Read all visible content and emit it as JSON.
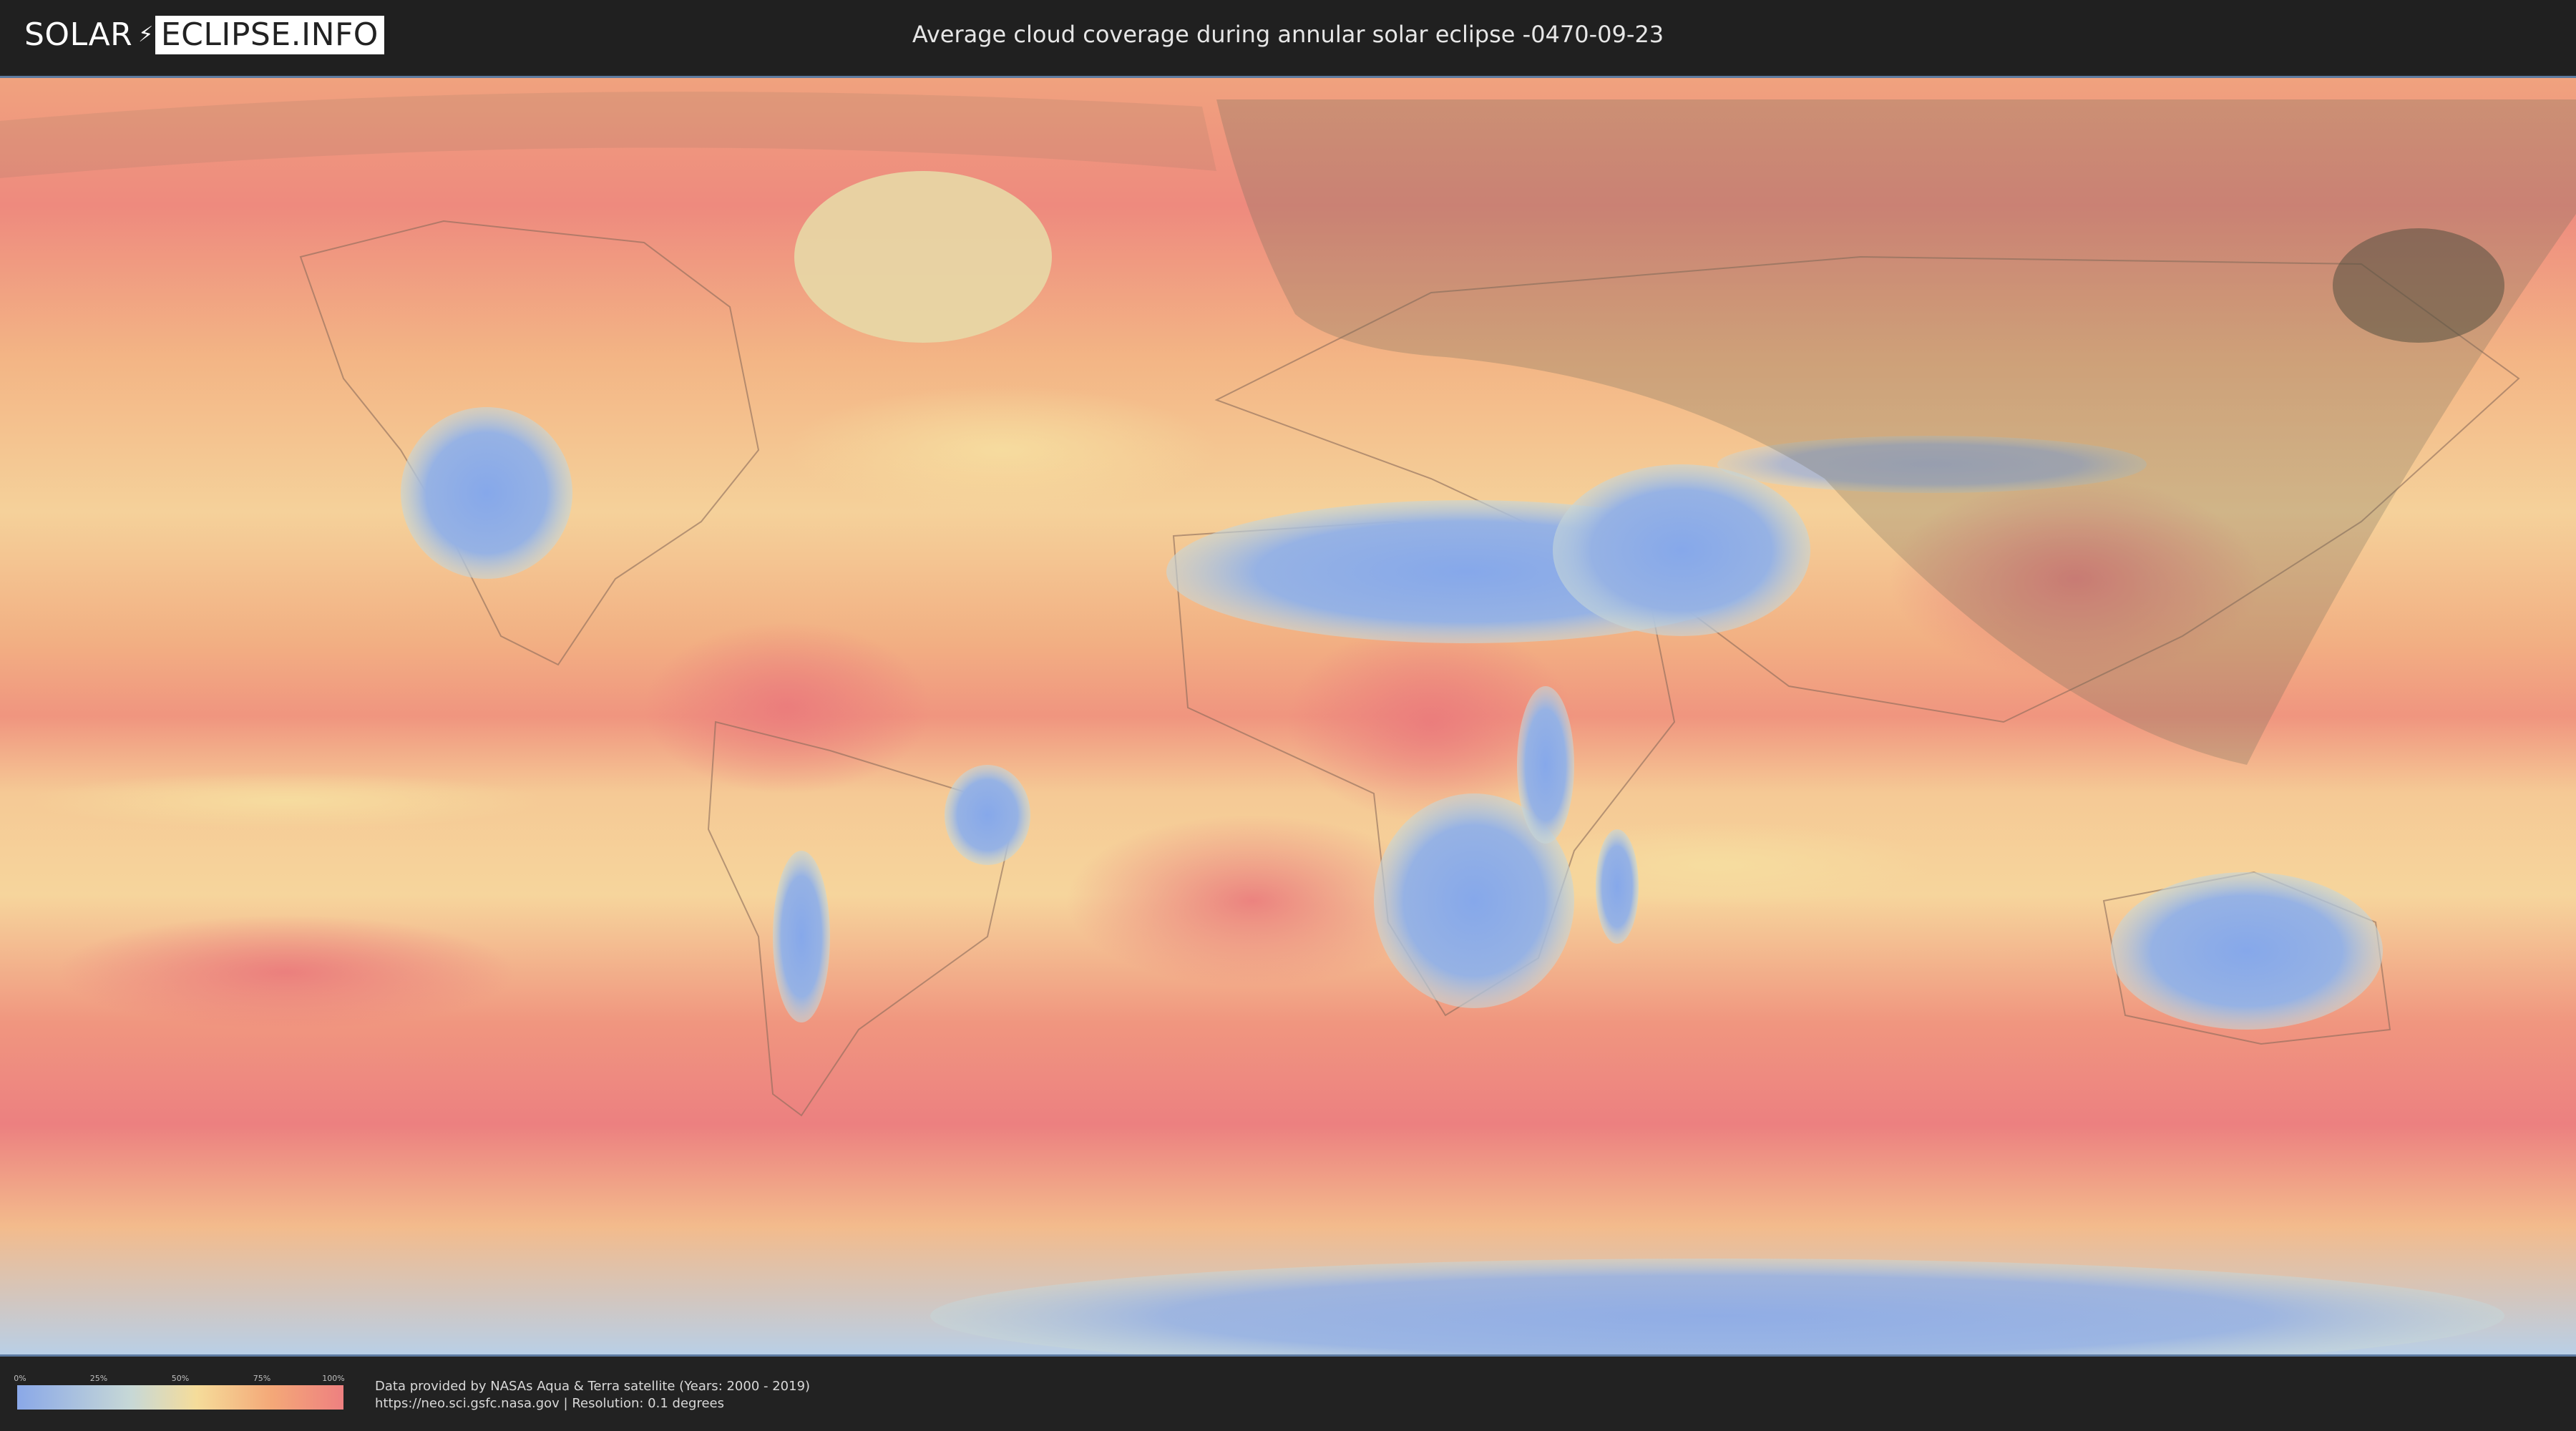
{
  "header": {
    "logo_left": "SOLAR",
    "logo_right": "ECLIPSE.INFO",
    "title": "Average cloud coverage during annular solar eclipse -0470-09-23"
  },
  "map": {
    "colors": {
      "clear": "#8aa8e8",
      "mid": "#f5dc9a",
      "cloudy": "#ee8080",
      "shadow": "#6e6a58"
    }
  },
  "legend": {
    "ticks": [
      "0%",
      "25%",
      "50%",
      "75%",
      "100%"
    ],
    "gradient": [
      "#8aa8e8",
      "#c7d8d6",
      "#f5dc9a",
      "#f4a878",
      "#ee8080"
    ]
  },
  "credits": {
    "line1": "Data provided by NASAs Aqua & Terra satellite (Years: 2000 - 2019)",
    "line2": "https://neo.sci.gsfc.nasa.gov | Resolution: 0.1 degrees"
  }
}
